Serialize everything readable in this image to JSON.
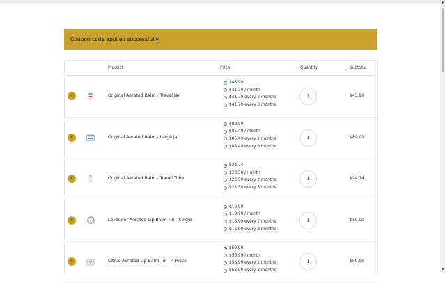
{
  "notice": "Coupon code applied successfully.",
  "headers": {
    "product": "Product",
    "price": "Price",
    "quantity": "Quantity",
    "subtotal": "Subtotal"
  },
  "rows": [
    {
      "product": "Original Aerated Balm - Travel Jar",
      "options": [
        "$43.99",
        "$41.79 / month",
        "$41.79 every 2 months",
        "$41.79 every 3 months"
      ],
      "selected_option": 0,
      "quantity": "1",
      "subtotal": "$43.99",
      "thumb_icon": "small-jar-icon"
    },
    {
      "product": "Original Aerated Balm - Large Jar",
      "options": [
        "$89.99",
        "$85.49 / month",
        "$85.49 every 2 months",
        "$85.49 every 3 months"
      ],
      "selected_option": 0,
      "quantity": "1",
      "subtotal": "$89.99",
      "thumb_icon": "large-jar-icon"
    },
    {
      "product": "Original Aerated Balm - Travel Tube",
      "options": [
        "$24.74",
        "$23.50 / month",
        "$23.50 every 2 months",
        "$23.50 every 3 months"
      ],
      "selected_option": 0,
      "quantity": "1",
      "subtotal": "$24.74",
      "thumb_icon": "tube-icon"
    },
    {
      "product": "Lavender Aerated Lip Balm Tin - Single",
      "options": [
        "$19.99",
        "$18.99 / month",
        "$18.99 every 2 months",
        "$18.99 every 3 months"
      ],
      "selected_option": 0,
      "quantity": "1",
      "subtotal": "$19.99",
      "thumb_icon": "tin-icon"
    },
    {
      "product": "Citrus Aerated Lip Balm Tin - 4 Piece",
      "options": [
        "$59.99",
        "$56.99 / month",
        "$56.99 every 2 months",
        "$56.99 every 3 months"
      ],
      "selected_option": 0,
      "quantity": "1",
      "subtotal": "$59.99",
      "thumb_icon": "tin-set-icon"
    }
  ],
  "colors": {
    "accent": "#c8a22c",
    "radio_selected": "#3a7bd5"
  }
}
